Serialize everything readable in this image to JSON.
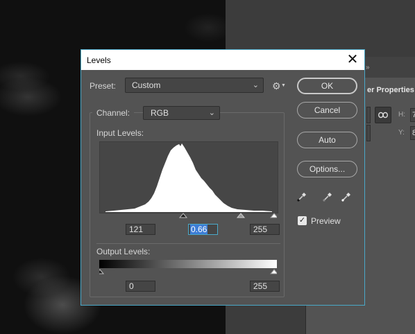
{
  "dialog": {
    "title": "Levels",
    "close_glyph": "✕",
    "preset": {
      "label": "Preset:",
      "value": "Custom"
    },
    "channel": {
      "label": "Channel:",
      "value": "RGB"
    },
    "input_levels": {
      "label": "Input Levels:",
      "black": "121",
      "gamma": "0.66",
      "white": "255"
    },
    "output_levels": {
      "label": "Output Levels:",
      "black": "0",
      "white": "255"
    },
    "buttons": {
      "ok": "OK",
      "cancel": "Cancel",
      "auto": "Auto",
      "options": "Options..."
    },
    "preview": {
      "label": "Preview",
      "checked": true
    },
    "colors": {
      "accent_border": "#4aa9c9",
      "selection": "#3d7dd6",
      "dialog_bg": "#535353"
    }
  },
  "background_panel": {
    "title": "er Properties",
    "tab_close": "»",
    "h_label": "H:",
    "h_value": "7",
    "y_label": "Y:",
    "y_value": "8",
    "link_icon": "link-icon"
  },
  "icons": {
    "gear": "gear-icon",
    "eyedroppers": [
      "black-point-eyedropper-icon",
      "gray-point-eyedropper-icon",
      "white-point-eyedropper-icon"
    ]
  }
}
